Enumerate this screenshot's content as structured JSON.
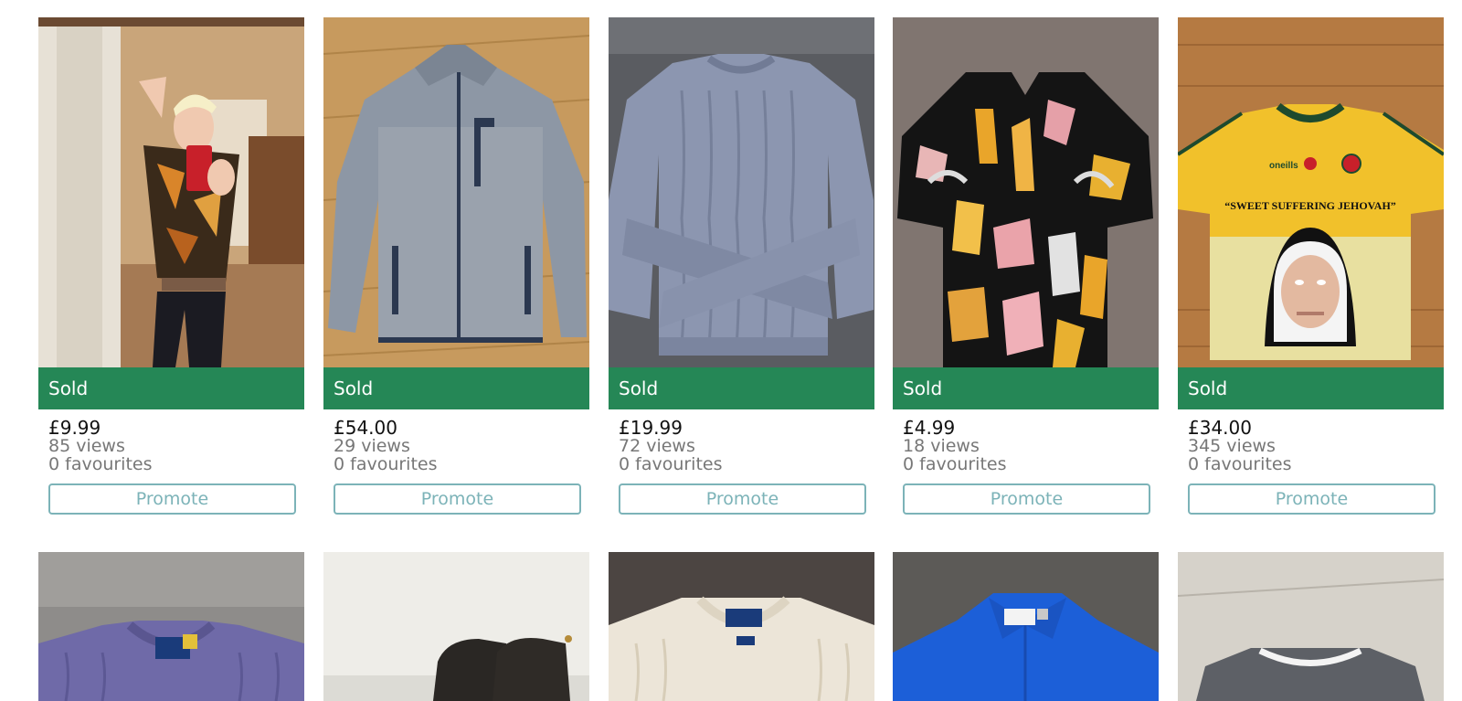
{
  "listings": [
    {
      "status": "Sold",
      "price": "£9.99",
      "views": "85 views",
      "favourites": "0 favourites",
      "promote_label": "Promote",
      "photo_desc": "man in patterned crop top selfie"
    },
    {
      "status": "Sold",
      "price": "£54.00",
      "views": "29 views",
      "favourites": "0 favourites",
      "promote_label": "Promote",
      "photo_desc": "grey zip fleece jacket"
    },
    {
      "status": "Sold",
      "price": "£19.99",
      "views": "72 views",
      "favourites": "0 favourites",
      "promote_label": "Promote",
      "photo_desc": "light blue cable knit jumper"
    },
    {
      "status": "Sold",
      "price": "£4.99",
      "views": "18 views",
      "favourites": "0 favourites",
      "promote_label": "Promote",
      "photo_desc": "black patterned shirt"
    },
    {
      "status": "Sold",
      "price": "£34.00",
      "views": "345 views",
      "favourites": "0 favourites",
      "promote_label": "Promote",
      "photo_desc": "yellow football jersey",
      "jersey_brand": "oneills",
      "jersey_text": "“SWEET SUFFERING JEHOVAH”"
    }
  ],
  "second_row": [
    {
      "photo_desc": "purple cable knit jumper"
    },
    {
      "photo_desc": "leather boots"
    },
    {
      "photo_desc": "cream cable knit jumper"
    },
    {
      "photo_desc": "blue polo shirt"
    },
    {
      "photo_desc": "grey sweatshirt"
    }
  ],
  "colors": {
    "sold_banner": "#258756",
    "promote_border": "#7cb3b8"
  }
}
